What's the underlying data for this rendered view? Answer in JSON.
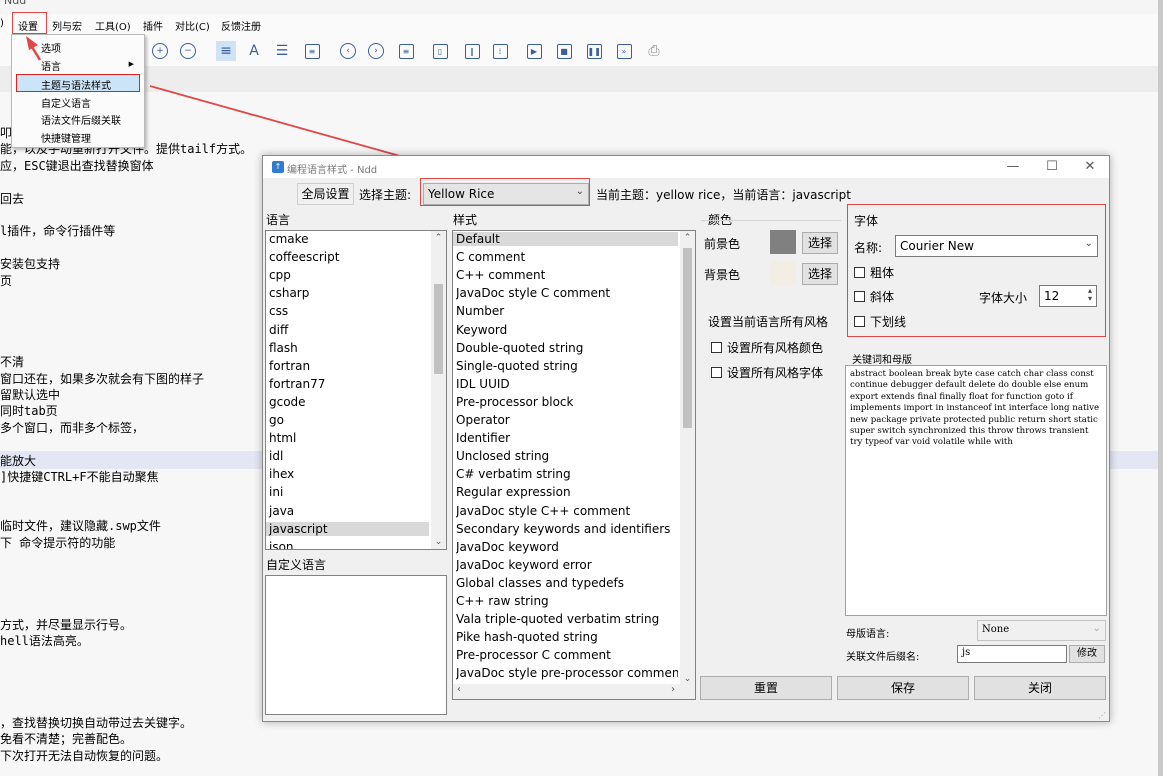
{
  "main": {
    "title": "Ndd",
    "menu": [
      "设置",
      "列与宏",
      "工具(O)",
      "插件",
      "对比(C)",
      "反馈注册"
    ],
    "menu_fragment": ")",
    "settings_menu": {
      "items": [
        "选项",
        "语言",
        "主题与语法样式",
        "自定义语言",
        "语法文件后缀关联",
        "快捷键管理"
      ],
      "selected": "主题与语法样式"
    },
    "editor_lines": [
      "叩",
      "能，以及手动重新打开文件。提供tailf方式。",
      "应，ESC键退出查找替换窗体",
      "回去",
      "l插件，命令行插件等",
      " 安装包支持",
      "页",
      "不清",
      "窗口还在，如果多次就会有下图的样子",
      "留默认选中",
      "同时tab页",
      "多个窗口，而非多个标签，",
      "能放大",
      "]快捷键CTRL+F不能自动聚焦",
      "临时文件，建议隐藏.swp文件",
      "下 命令提示符的功能",
      "方式，并尽量显示行号。",
      "hell语法高亮。",
      "，查找替换切换自动带过去关键字。",
      "免看不清楚；完善配色。",
      "下次打开无法自动恢复的问题。"
    ]
  },
  "dialog": {
    "title": "编程语言样式 - Ndd",
    "global_settings_button": "全局设置",
    "select_theme_label": "选择主题:",
    "theme_value": "Yellow Rice",
    "current_info": "当前主题：yellow rice，当前语言：javascript",
    "language_label": "语言",
    "languages": [
      "cmake",
      "coffeescript",
      "cpp",
      "csharp",
      "css",
      "diff",
      "flash",
      "fortran",
      "fortran77",
      "gcode",
      "go",
      "html",
      "idl",
      "ihex",
      "ini",
      "java",
      "javascript",
      "json"
    ],
    "selected_language": "javascript",
    "custom_language_label": "自定义语言",
    "style_label": "样式",
    "styles": [
      "Default",
      "C comment",
      "C++ comment",
      "JavaDoc style C comment",
      "Number",
      "Keyword",
      "Double-quoted string",
      "Single-quoted string",
      "IDL UUID",
      "Pre-processor block",
      "Operator",
      "Identifier",
      "Unclosed string",
      "C# verbatim string",
      "Regular expression",
      "JavaDoc style C++ comment",
      "Secondary keywords and identifiers",
      "JavaDoc keyword",
      "JavaDoc keyword error",
      "Global classes and typedefs",
      "C++ raw string",
      "Vala triple-quoted verbatim string",
      "Pike hash-quoted string",
      "Pre-processor C comment",
      "JavaDoc style pre-processor commen"
    ],
    "selected_style": "Default",
    "color": {
      "label": "颜色",
      "foreground_label": "前景色",
      "background_label": "背景色",
      "select_button": "选择",
      "foreground_color": "#808080",
      "background_color": "#f2eee3"
    },
    "apply_all_label": "设置当前语言所有风格",
    "apply_all_color": "设置所有风格颜色",
    "apply_all_font": "设置所有风格字体",
    "font": {
      "label": "字体",
      "name_label": "名称:",
      "name_value": "Courier New",
      "bold": "粗体",
      "italic": "斜体",
      "underline": "下划线",
      "size_label": "字体大小",
      "size_value": "12"
    },
    "keywords_label": "关键词和母版",
    "keywords": "abstract boolean break byte case catch char class const continue debugger default delete do double else enum export extends final finally float for function goto if implements import in instanceof int interface long native new package private protected public return short static super switch synchronized this throw throws transient try typeof var void volatile while with",
    "mother_language_label": "母版语言:",
    "mother_language_value": "None",
    "assoc_ext_label": "关联文件后缀名:",
    "assoc_ext_value": "js",
    "modify_button": "修改",
    "reset_button": "重置",
    "save_button": "保存",
    "close_button": "关闭"
  }
}
